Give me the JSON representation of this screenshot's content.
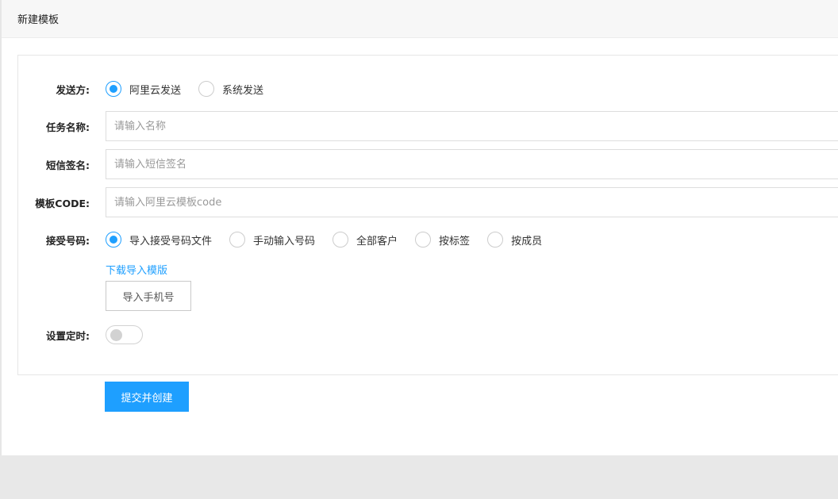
{
  "header": {
    "title": "新建模板"
  },
  "form": {
    "sender": {
      "label": "发送方:",
      "options": [
        "阿里云发送",
        "系统发送"
      ]
    },
    "task_name": {
      "label": "任务名称:",
      "placeholder": "请输入名称"
    },
    "sign": {
      "label": "短信签名:",
      "placeholder": "请输入短信签名"
    },
    "template_code": {
      "label": "模板CODE:",
      "placeholder": "请输入阿里云模板code"
    },
    "receiver": {
      "label": "接受号码:",
      "options": [
        "导入接受号码文件",
        "手动输入号码",
        "全部客户",
        "按标签",
        "按成员"
      ]
    },
    "download_link": "下载导入模版",
    "import_button": "导入手机号",
    "timer": {
      "label": "设置定时:",
      "enabled": false
    }
  },
  "submit_label": "提交并创建"
}
